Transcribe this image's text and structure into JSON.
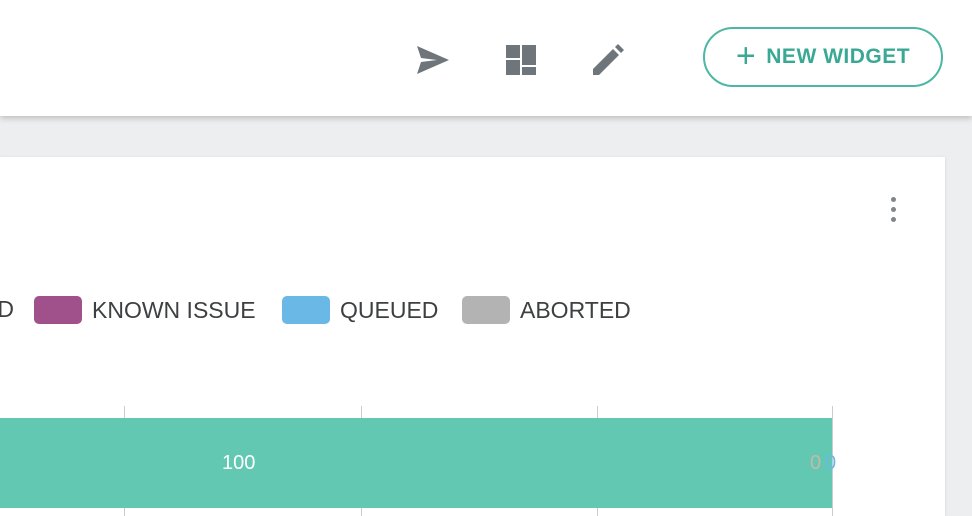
{
  "toolbar": {
    "send_icon": "send-icon",
    "dashboard_icon": "dashboard-icon",
    "edit_icon": "edit-icon",
    "new_widget_label": "NEW WIDGET",
    "plus_glyph": "+"
  },
  "widget": {
    "menu_icon": "more-vertical-icon",
    "legend_clipped_text": "D",
    "legend": [
      {
        "label": "KNOWN ISSUE",
        "color": "#a0508a"
      },
      {
        "label": "QUEUED",
        "color": "#6ab8e6"
      },
      {
        "label": "ABORTED",
        "color": "#b3b3b3"
      }
    ],
    "bar": {
      "value_label": "100",
      "color": "#62c8b2"
    },
    "zero_labels": [
      {
        "text": "0",
        "color": "#c6b8aa"
      },
      {
        "text": "0",
        "color": "#6ab8e6"
      }
    ]
  },
  "colors": {
    "accent": "#3aa994",
    "background": "#eceef0"
  }
}
